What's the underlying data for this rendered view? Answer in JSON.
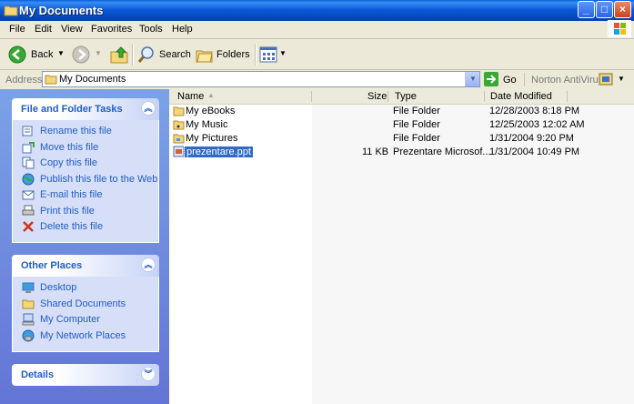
{
  "window": {
    "title": "My Documents"
  },
  "menu": [
    "File",
    "Edit",
    "View",
    "Favorites",
    "Tools",
    "Help"
  ],
  "toolbar": {
    "back": "Back",
    "search": "Search",
    "folders": "Folders"
  },
  "address": {
    "label": "Address",
    "value": "My Documents",
    "go": "Go",
    "antivirus": "Norton AntiVirus"
  },
  "left": {
    "file_tasks": {
      "title": "File and Folder Tasks",
      "items": [
        "Rename this file",
        "Move this file",
        "Copy this file",
        "Publish this file to the Web",
        "E-mail this file",
        "Print this file",
        "Delete this file"
      ]
    },
    "other_places": {
      "title": "Other Places",
      "items": [
        "Desktop",
        "Shared Documents",
        "My Computer",
        "My Network Places"
      ]
    },
    "details": {
      "title": "Details"
    }
  },
  "list": {
    "columns": [
      "Name",
      "Size",
      "Type",
      "Date Modified"
    ],
    "rows": [
      {
        "name": "My eBooks",
        "size": "",
        "type": "File Folder",
        "date": "12/28/2003 8:18 PM"
      },
      {
        "name": "My Music",
        "size": "",
        "type": "File Folder",
        "date": "12/25/2003 12:02 AM"
      },
      {
        "name": "My Pictures",
        "size": "",
        "type": "File Folder",
        "date": "1/31/2004 9:20 PM"
      },
      {
        "name": "prezentare.ppt",
        "size": "11 KB",
        "type": "Prezentare Microsof...",
        "date": "1/31/2004 10:49 PM"
      }
    ]
  },
  "colors": {
    "title_blue": "#0a5fd8",
    "link_blue": "#215dc6",
    "selection": "#316ac5"
  }
}
